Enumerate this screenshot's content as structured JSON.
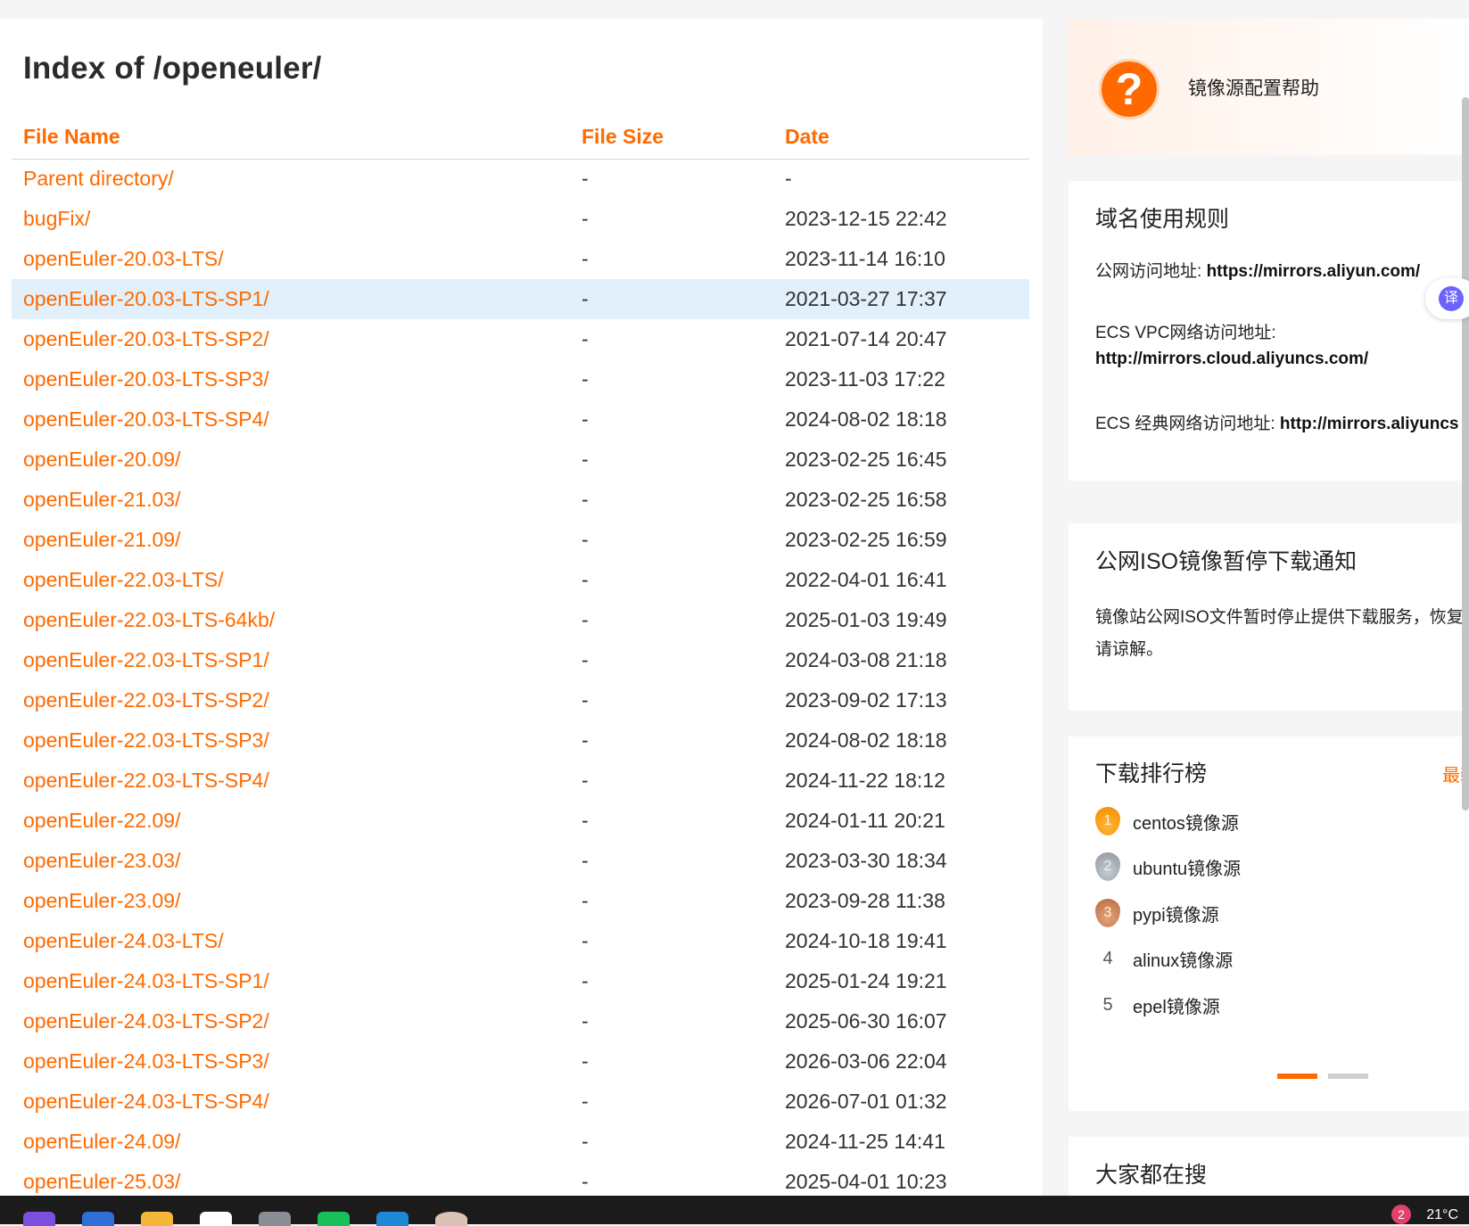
{
  "page": {
    "title": "Index of /openeuler/"
  },
  "table": {
    "headers": {
      "name": "File Name",
      "size": "File Size",
      "date": "Date"
    },
    "rows": [
      {
        "name": "Parent directory/",
        "size": "-",
        "date": "-"
      },
      {
        "name": "bugFix/",
        "size": "-",
        "date": "2023-12-15 22:42"
      },
      {
        "name": "openEuler-20.03-LTS/",
        "size": "-",
        "date": "2023-11-14 16:10"
      },
      {
        "name": "openEuler-20.03-LTS-SP1/",
        "size": "-",
        "date": "2021-03-27 17:37"
      },
      {
        "name": "openEuler-20.03-LTS-SP2/",
        "size": "-",
        "date": "2021-07-14 20:47"
      },
      {
        "name": "openEuler-20.03-LTS-SP3/",
        "size": "-",
        "date": "2023-11-03 17:22"
      },
      {
        "name": "openEuler-20.03-LTS-SP4/",
        "size": "-",
        "date": "2024-08-02 18:18"
      },
      {
        "name": "openEuler-20.09/",
        "size": "-",
        "date": "2023-02-25 16:45"
      },
      {
        "name": "openEuler-21.03/",
        "size": "-",
        "date": "2023-02-25 16:58"
      },
      {
        "name": "openEuler-21.09/",
        "size": "-",
        "date": "2023-02-25 16:59"
      },
      {
        "name": "openEuler-22.03-LTS/",
        "size": "-",
        "date": "2022-04-01 16:41"
      },
      {
        "name": "openEuler-22.03-LTS-64kb/",
        "size": "-",
        "date": "2025-01-03 19:49"
      },
      {
        "name": "openEuler-22.03-LTS-SP1/",
        "size": "-",
        "date": "2024-03-08 21:18"
      },
      {
        "name": "openEuler-22.03-LTS-SP2/",
        "size": "-",
        "date": "2023-09-02 17:13"
      },
      {
        "name": "openEuler-22.03-LTS-SP3/",
        "size": "-",
        "date": "2024-08-02 18:18"
      },
      {
        "name": "openEuler-22.03-LTS-SP4/",
        "size": "-",
        "date": "2024-11-22 18:12"
      },
      {
        "name": "openEuler-22.09/",
        "size": "-",
        "date": "2024-01-11 20:21"
      },
      {
        "name": "openEuler-23.03/",
        "size": "-",
        "date": "2023-03-30 18:34"
      },
      {
        "name": "openEuler-23.09/",
        "size": "-",
        "date": "2023-09-28 11:38"
      },
      {
        "name": "openEuler-24.03-LTS/",
        "size": "-",
        "date": "2024-10-18 19:41"
      },
      {
        "name": "openEuler-24.03-LTS-SP1/",
        "size": "-",
        "date": "2025-01-24 19:21"
      },
      {
        "name": "openEuler-24.03-LTS-SP2/",
        "size": "-",
        "date": "2025-06-30 16:07"
      },
      {
        "name": "openEuler-24.03-LTS-SP3/",
        "size": "-",
        "date": "2026-03-06 22:04"
      },
      {
        "name": "openEuler-24.03-LTS-SP4/",
        "size": "-",
        "date": "2026-07-01 01:32"
      },
      {
        "name": "openEuler-24.09/",
        "size": "-",
        "date": "2024-11-25 14:41"
      },
      {
        "name": "openEuler-25.03/",
        "size": "-",
        "date": "2025-04-01 10:23"
      }
    ]
  },
  "sidebar": {
    "help": {
      "icon": "question-icon",
      "label": "镜像源配置帮助"
    },
    "domain": {
      "title": "域名使用规则",
      "public_label": "公网访问地址: ",
      "public_url": "https://mirrors.aliyun.com/",
      "vpc_label": "ECS VPC网络访问地址:",
      "vpc_url": "http://mirrors.cloud.aliyuncs.com/",
      "classic_label": "ECS 经典网络访问地址: ",
      "classic_url": "http://mirrors.aliyuncs"
    },
    "iso": {
      "title": "公网ISO镜像暂停下载通知",
      "text": "镜像站公网ISO文件暂时停止提供下载服务，恢复定，敬请谅解。"
    },
    "ranking": {
      "title": "下载排行榜",
      "more": "最新",
      "items": [
        {
          "rank": "1",
          "label": "centos镜像源"
        },
        {
          "rank": "2",
          "label": "ubuntu镜像源"
        },
        {
          "rank": "3",
          "label": "pypi镜像源"
        },
        {
          "rank": "4",
          "label": "alinux镜像源"
        },
        {
          "rank": "5",
          "label": "epel镜像源"
        }
      ]
    },
    "search": {
      "title": "大家都在搜"
    }
  },
  "translate_button": {
    "label": "译"
  },
  "taskbar": {
    "weather": "21°C",
    "notification_count": "2"
  },
  "colors": {
    "accent": "#ff6a00",
    "highlight_row": "#e1f0fa"
  }
}
